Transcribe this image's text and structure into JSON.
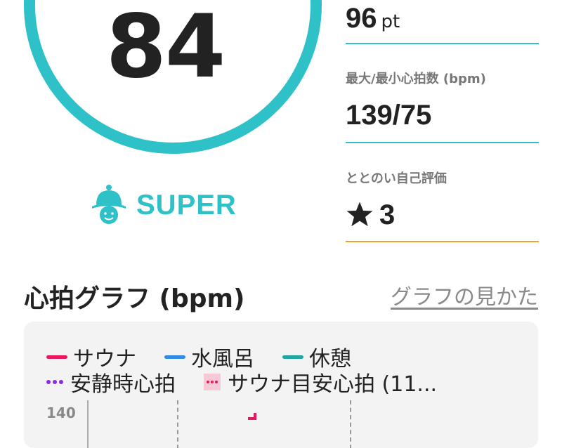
{
  "score": {
    "value": "84"
  },
  "rank": {
    "label": "SUPER",
    "icon": "helmet-mascot-icon"
  },
  "stats": {
    "points": {
      "value": "96",
      "unit": "pt"
    },
    "heart_rate": {
      "label": "最大/最小心拍数 (bpm)",
      "value": "139/75"
    },
    "self_rating": {
      "label": "ととのい自己評価",
      "value": "3",
      "icon": "star-icon"
    }
  },
  "section": {
    "title": "心拍グラフ (bpm)",
    "guide_link": "グラフの見かた"
  },
  "chart": {
    "legend": [
      {
        "name": "サウナ",
        "style": "line",
        "color": "#e8185e"
      },
      {
        "name": "水風呂",
        "style": "line",
        "color": "#2f8be6"
      },
      {
        "name": "休憩",
        "style": "line",
        "color": "#1fa5a5"
      },
      {
        "name": "安静時心拍",
        "style": "dots",
        "color": "#8a2be2"
      },
      {
        "name": "サウナ目安心拍 (11...",
        "style": "box",
        "color": "#e8185e",
        "fill": "#f7c9d6"
      }
    ],
    "y_tick": "140"
  },
  "colors": {
    "accent": "#2ec1c8",
    "orange": "#f0a030",
    "text": "#222222",
    "muted": "#777777"
  }
}
